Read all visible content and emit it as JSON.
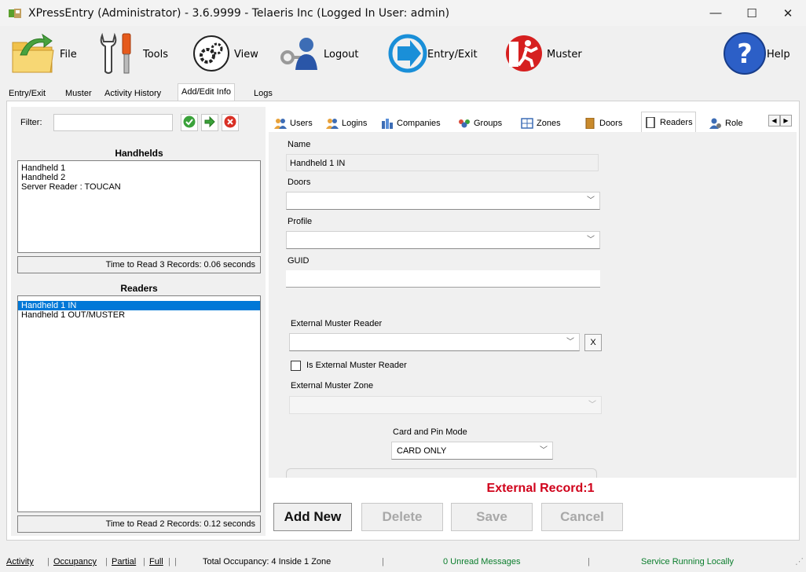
{
  "window": {
    "title": "XPressEntry (Administrator)  - 3.6.9999 - Telaeris Inc (Logged In User: admin)",
    "minimize": "—",
    "maximize": "☐",
    "close": "✕"
  },
  "toolbar": {
    "file": "File",
    "tools": "Tools",
    "view": "View",
    "logout": "Logout",
    "entry_exit": "Entry/Exit",
    "muster": "Muster",
    "help": "Help"
  },
  "main_tabs": [
    "Entry/Exit",
    "Muster",
    "Activity History",
    "Add/Edit Info",
    "Logs"
  ],
  "left": {
    "filter_label": "Filter:",
    "filter_value": "",
    "handhelds_title": "Handhelds",
    "handhelds": [
      "Handheld 1",
      "Handheld 2",
      "Server Reader : TOUCAN"
    ],
    "handhelds_time": "Time to Read 3 Records: 0.06 seconds",
    "readers_title": "Readers",
    "readers": [
      "Handheld 1 IN",
      "Handheld 1 OUT/MUSTER"
    ],
    "readers_time": "Time to Read 2 Records: 0.12 seconds"
  },
  "sub_tabs": [
    "Users",
    "Logins",
    "Companies",
    "Groups",
    "Zones",
    "Doors",
    "Readers",
    "Role"
  ],
  "form": {
    "name_label": "Name",
    "name_value": "Handheld 1 IN",
    "doors_label": "Doors",
    "doors_value": "",
    "profile_label": "Profile",
    "profile_value": "",
    "guid_label": "GUID",
    "guid_value": "",
    "ext_muster_reader_label": "External Muster Reader",
    "ext_muster_reader_value": "",
    "clear_button": "X",
    "is_ext_muster_label": "Is External Muster Reader",
    "ext_muster_zone_label": "External Muster Zone",
    "ext_muster_zone_value": "",
    "card_pin_label": "Card and Pin Mode",
    "card_pin_value": "CARD ONLY"
  },
  "external_record": "External Record:1",
  "actions": {
    "add_new": "Add New",
    "delete": "Delete",
    "save": "Save",
    "cancel": "Cancel"
  },
  "statusbar": {
    "tabs": [
      "Activity",
      "Occupancy",
      "Partial",
      "Full"
    ],
    "occupancy": "Total Occupancy: 4 Inside 1 Zone",
    "messages": "0 Unread Messages",
    "service": "Service Running Locally"
  },
  "colors": {
    "selection": "#0078d7",
    "external_record": "#d0021b",
    "messages": "#0a7d2c",
    "service": "#0a7d2c"
  }
}
